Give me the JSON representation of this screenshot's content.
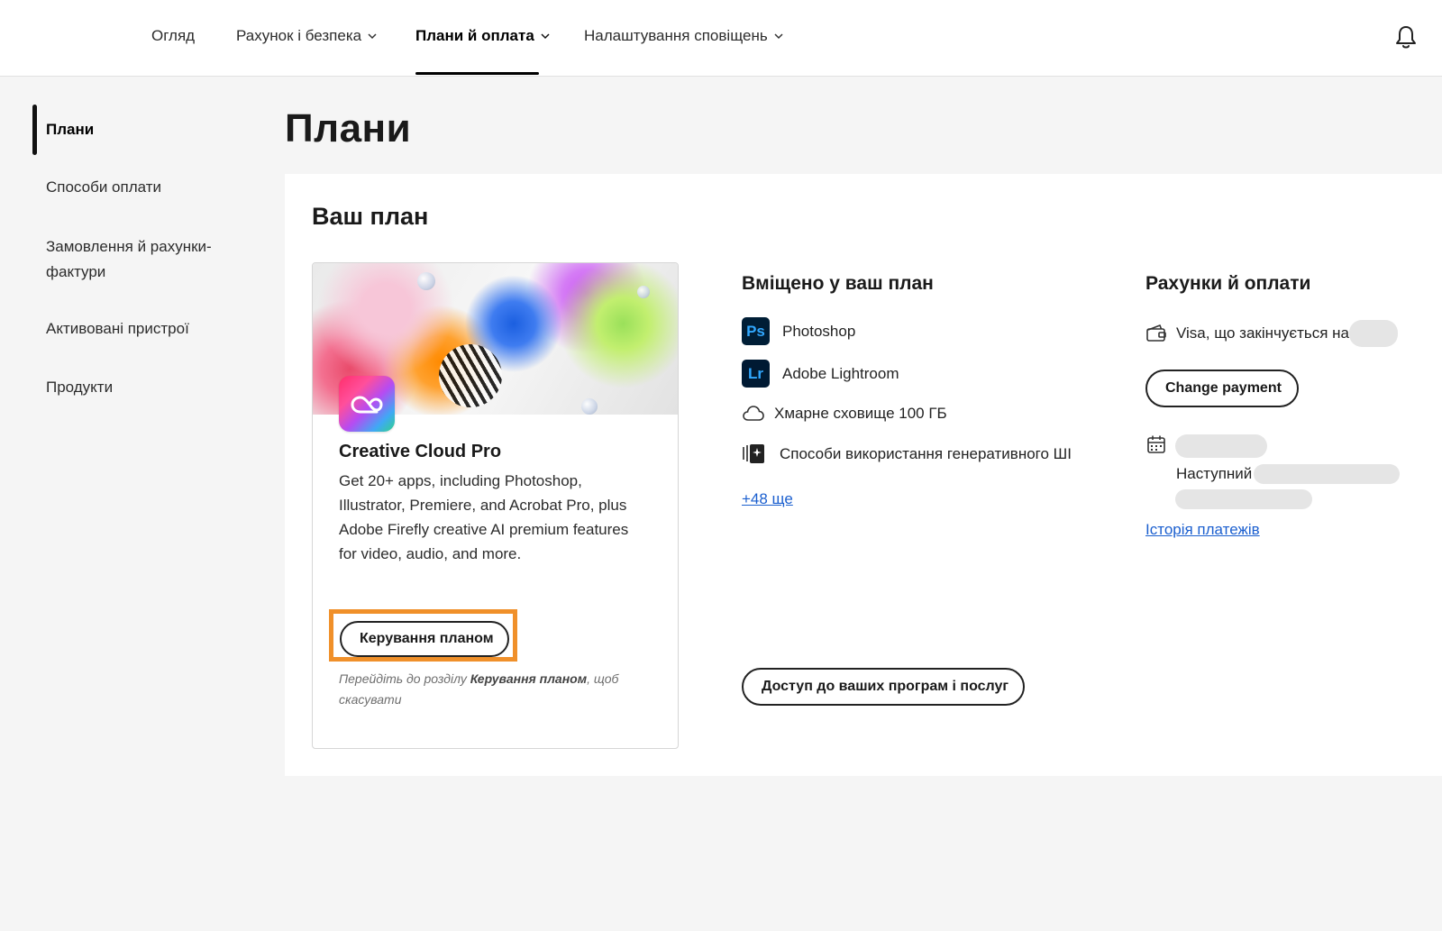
{
  "nav": {
    "items": [
      {
        "label": "Огляд",
        "has_dropdown": false
      },
      {
        "label": "Рахунок і безпека",
        "has_dropdown": true
      },
      {
        "label": "Плани й оплата",
        "has_dropdown": true,
        "active": true
      },
      {
        "label": "Налаштування сповіщень",
        "has_dropdown": true
      }
    ],
    "notifications_icon": "bell-icon"
  },
  "sidebar": {
    "items": [
      {
        "label": "Плани",
        "active": true
      },
      {
        "label": "Способи оплати"
      },
      {
        "label": "Замовлення й рахунки-фактури"
      },
      {
        "label": "Активовані пристрої"
      },
      {
        "label": "Продукти"
      }
    ]
  },
  "page": {
    "title": "Плани"
  },
  "plan_section": {
    "title": "Ваш план",
    "card": {
      "name": "Creative Cloud Pro",
      "description": "Get 20+ apps, including Photoshop, Illustrator, Premiere, and Acrobat Pro, plus Adobe Firefly creative AI premium features for video, audio, and more.",
      "manage_button": "Керування планом",
      "hint_prefix": "Перейдіть до розділу ",
      "hint_bold": "Керування планом",
      "hint_suffix": ", щоб скасувати"
    }
  },
  "included": {
    "title": "Вміщено у ваш план",
    "items": [
      {
        "icon": "photoshop-icon",
        "icon_text": "Ps",
        "label": "Photoshop"
      },
      {
        "icon": "lightroom-icon",
        "icon_text": "Lr",
        "label": "Adobe Lightroom"
      },
      {
        "icon": "cloud-icon",
        "label": "Хмарне сховище 100 ГБ"
      },
      {
        "icon": "generative-ai-icon",
        "label": "Способи використання генеративного ШІ"
      }
    ],
    "more_link": "+48 ще",
    "access_button": "Доступ до ваших програм і послуг"
  },
  "billing": {
    "title": "Рахунки й оплати",
    "card_label": "Visa, що закінчується на",
    "change_payment_button": "Change payment",
    "next_label": "Наступний",
    "history_link": "Історія платежів"
  },
  "colors": {
    "highlight": "#f0902a",
    "link": "#1b5fcf",
    "panel_bg": "#ffffff",
    "page_bg": "#f5f5f5"
  }
}
